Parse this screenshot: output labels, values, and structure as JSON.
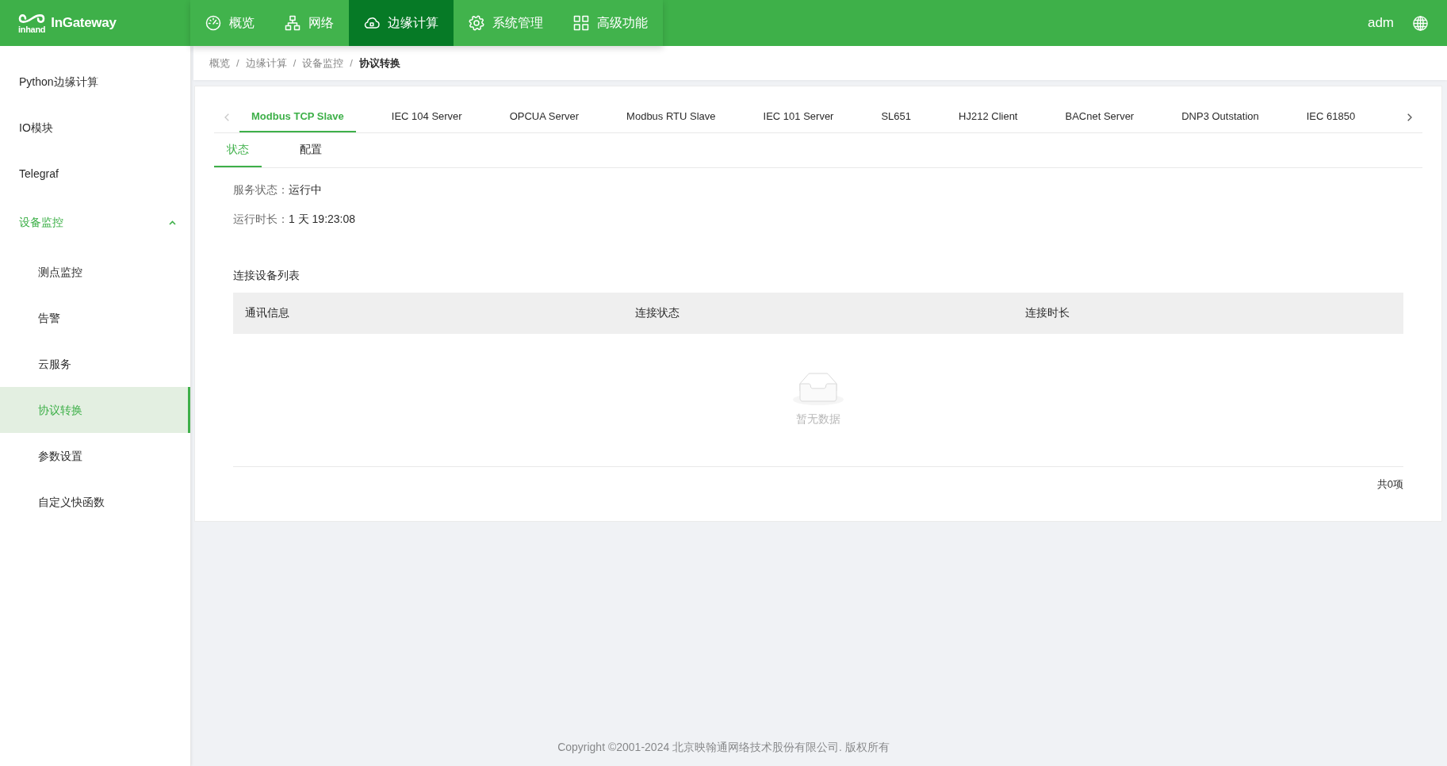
{
  "header": {
    "logo": {
      "mark_text": "inhand",
      "product": "InGateway"
    },
    "nav": [
      {
        "label": "概览",
        "selected": false
      },
      {
        "label": "网络",
        "selected": false
      },
      {
        "label": "边缘计算",
        "selected": true
      },
      {
        "label": "系统管理",
        "selected": false
      },
      {
        "label": "高级功能",
        "selected": false
      }
    ],
    "user": "adm"
  },
  "sidebar": {
    "items": [
      {
        "kind": "item",
        "label": "Python边缘计算",
        "selected": false
      },
      {
        "kind": "item",
        "label": "IO模块",
        "selected": false
      },
      {
        "kind": "item",
        "label": "Telegraf",
        "selected": false
      },
      {
        "kind": "submenu",
        "label": "设备监控",
        "selected": true,
        "expanded": true,
        "children": [
          {
            "label": "测点监控",
            "selected": false
          },
          {
            "label": "告警",
            "selected": false
          },
          {
            "label": "云服务",
            "selected": false
          },
          {
            "label": "协议转换",
            "selected": true
          },
          {
            "label": "参数设置",
            "selected": false
          },
          {
            "label": "自定义快函数",
            "selected": false
          }
        ]
      }
    ]
  },
  "breadcrumb": [
    {
      "label": "概览",
      "separator": "/",
      "current": false
    },
    {
      "label": "边缘计算",
      "separator": "/",
      "current": false
    },
    {
      "label": "设备监控",
      "separator": "/",
      "current": false
    },
    {
      "label": "协议转换",
      "current": true
    }
  ],
  "protocol_tabs": {
    "prev_disabled": true,
    "next_disabled": false,
    "tabs": [
      {
        "label": "Modbus TCP Slave",
        "selected": true
      },
      {
        "label": "IEC 104 Server",
        "selected": false
      },
      {
        "label": "OPCUA Server",
        "selected": false
      },
      {
        "label": "Modbus RTU Slave",
        "selected": false
      },
      {
        "label": "IEC 101 Server",
        "selected": false
      },
      {
        "label": "SL651",
        "selected": false
      },
      {
        "label": "HJ212 Client",
        "selected": false
      },
      {
        "label": "BACnet Server",
        "selected": false
      },
      {
        "label": "DNP3 Outstation",
        "selected": false
      },
      {
        "label": "IEC 61850",
        "selected": false
      }
    ]
  },
  "sub_tabs": [
    {
      "label": "状态",
      "selected": true
    },
    {
      "label": "配置",
      "selected": false
    }
  ],
  "status": [
    {
      "label": "服务状态：",
      "value": "运行中"
    },
    {
      "label": "运行时长：",
      "value": "1 天 19:23:08"
    }
  ],
  "device_table": {
    "title": "连接设备列表",
    "columns": [
      "通讯信息",
      "连接状态",
      "连接时长"
    ],
    "empty_text": "暂无数据",
    "total": "共0项"
  },
  "footer": {
    "copyright": "Copyright ©2001-2024 北京映翰通网络技术股份有限公司. 版权所有"
  }
}
